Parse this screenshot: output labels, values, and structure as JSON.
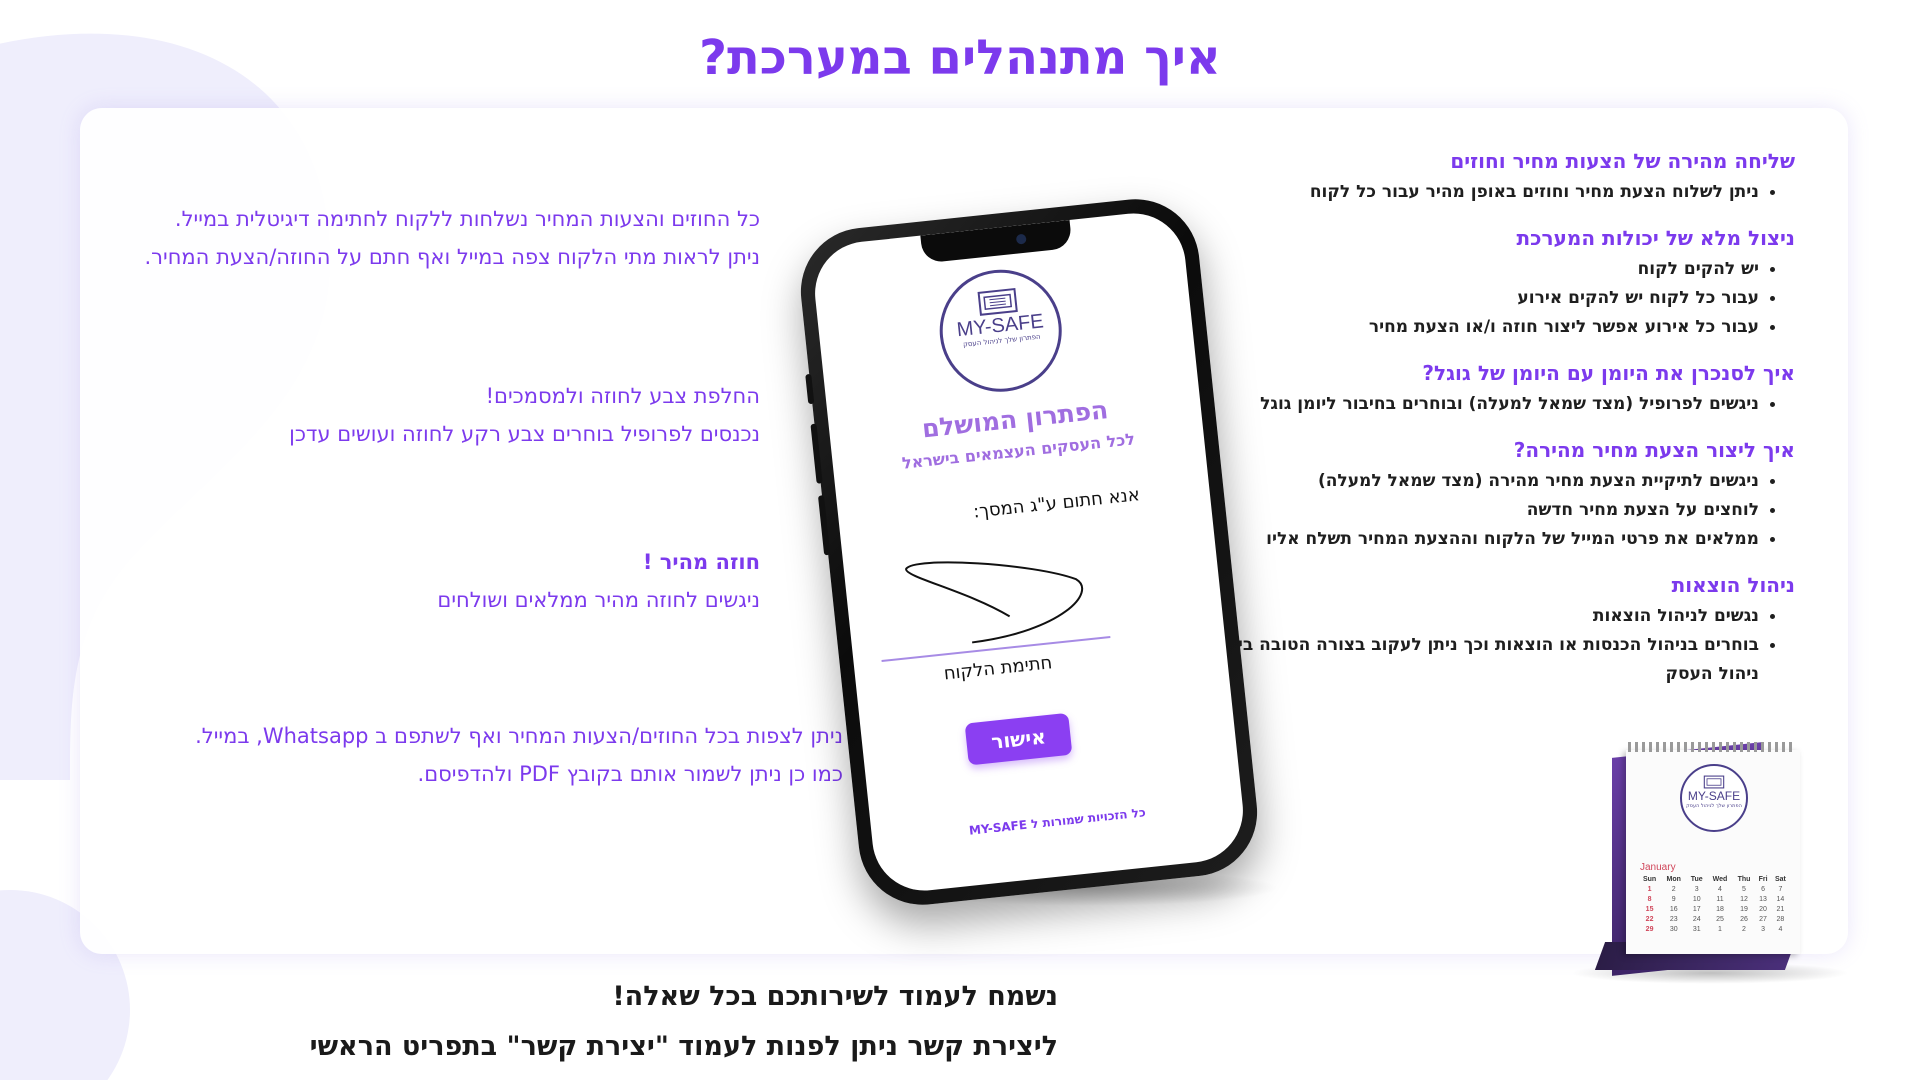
{
  "page": {
    "title": "איך מתנהלים במערכת?",
    "colors": {
      "accent": "#7c3aed",
      "button": "#8b3ff2",
      "text": "#1a1a1a"
    }
  },
  "sections": [
    {
      "title": "שליחה מהירה של הצעות מחיר וחוזים",
      "items": [
        "ניתן לשלוח הצעת מחיר וחוזים באופן מהיר עבור כל לקוח"
      ]
    },
    {
      "title": "ניצול מלא של יכולות המערכת",
      "items": [
        "יש להקים לקוח",
        "עבור כל לקוח יש להקים אירוע",
        "עבור כל אירוע אפשר ליצור חוזה ו/או הצעת מחיר"
      ]
    },
    {
      "title": "איך לסנכרן את היומן עם היומן של גוגל?",
      "items": [
        "ניגשים לפרופיל (מצד שמאל למעלה) ובוחרים בחיבור ליומן גוגל"
      ]
    },
    {
      "title": "איך ליצור הצעת מחיר מהירה?",
      "items": [
        "ניגשים לתיקיית הצעת מחיר מהירה (מצד שמאל למעלה)",
        "לוחצים על הצעת מחיר חדשה",
        "ממלאים את פרטי המייל של הלקוח וההצעת המחיר תשלח אליו"
      ]
    },
    {
      "title": "ניהול הוצאות",
      "items": [
        "נגשים לניהול הוצאות",
        "בוחרים בניהול הכנסות או הוצאות וכך ניתן לעקוב בצורה הטובה ביותר על ניהול העסק"
      ]
    }
  ],
  "left_blocks": [
    {
      "lines": [
        "כל החוזים והצעות המחיר נשלחות ללקוח לחתימה דיגיטלית במייל.",
        "ניתן לראות מתי הלקוח צפה במייל ואף חתם על החוזה/הצעת המחיר."
      ]
    },
    {
      "lines": [
        "החלפת צבע לחוזה ולמסמכים!",
        "נכנסים לפרופיל בוחרים צבע רקע לחוזה ועושים עדכן"
      ]
    },
    {
      "lines": [
        "חוזה מהיר !",
        "ניגשים לחוזה מהיר ממלאים ושולחים"
      ]
    },
    {
      "lines": [
        "ניתן לצפות בכל החוזים/הצעות המחיר ואף לשתפם ב Whatsapp, במייל.",
        "כמו כן ניתן לשמור אותם בקובץ PDF ולהדפיסם."
      ]
    }
  ],
  "phone": {
    "logo": "MY-SAFE",
    "logo_tagline": "הפתרון שלך לניהול העסק",
    "headline": "הפתרון המושלם",
    "subheadline": "לכל העסקים העצמאים בישראל",
    "sign_label": "אנא חתום ע\"ג המסך:",
    "sign_caption": "חתימת הלקוח",
    "confirm_button": "אישור",
    "footer": "כל הזכויות שמורות ל MY-SAFE"
  },
  "calendar": {
    "logo": "MY-SAFE",
    "logo_tagline": "הפתרון שלך לניהול העסק",
    "month": "January",
    "weekdays": [
      "Sun",
      "Mon",
      "Tue",
      "Wed",
      "Thu",
      "Fri",
      "Sat"
    ],
    "weeks": [
      [
        "",
        "",
        "",
        "",
        "",
        "",
        ""
      ],
      [
        "1",
        "2",
        "3",
        "4",
        "5",
        "6",
        "7"
      ],
      [
        "8",
        "9",
        "10",
        "11",
        "12",
        "13",
        "14"
      ],
      [
        "15",
        "16",
        "17",
        "18",
        "19",
        "20",
        "21"
      ],
      [
        "22",
        "23",
        "24",
        "25",
        "26",
        "27",
        "28"
      ],
      [
        "29",
        "30",
        "31",
        "1",
        "2",
        "3",
        "4"
      ]
    ]
  },
  "bottom": {
    "line1": "נשמח לעמוד לשירותכם בכל שאלה!",
    "line2": "ליצירת קשר ניתן לפנות לעמוד \"יצירת קשר\" בתפריט הראשי"
  }
}
